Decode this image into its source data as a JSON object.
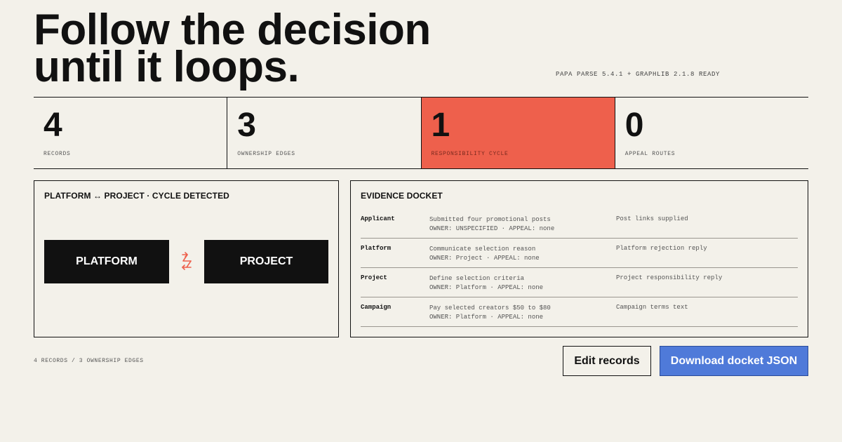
{
  "header": {
    "headline_line1": "Follow the decision",
    "headline_line2": "until it loops.",
    "status": "PAPA PARSE 5.4.1 + GRAPHLIB 2.1.8 READY"
  },
  "stats": [
    {
      "value": "4",
      "label": "RECORDS"
    },
    {
      "value": "3",
      "label": "OWNERSHIP EDGES"
    },
    {
      "value": "1",
      "label": "RESPONSIBILITY CYCLE"
    },
    {
      "value": "0",
      "label": "APPEAL ROUTES"
    }
  ],
  "graph_panel": {
    "title": "PLATFORM ↔ PROJECT · CYCLE DETECTED",
    "node_a": "PLATFORM",
    "node_b": "PROJECT",
    "cycle_icon": "swap-arrows-icon"
  },
  "docket_panel": {
    "title": "EVIDENCE DOCKET",
    "rows": [
      {
        "name": "Applicant",
        "desc": "Submitted four promotional posts",
        "meta": "OWNER: UNSPECIFIED · APPEAL: none",
        "evidence": "Post links supplied"
      },
      {
        "name": "Platform",
        "desc": "Communicate selection reason",
        "meta": "OWNER: Project · APPEAL: none",
        "evidence": "Platform rejection reply"
      },
      {
        "name": "Project",
        "desc": "Define selection criteria",
        "meta": "OWNER: Platform · APPEAL: none",
        "evidence": "Project responsibility reply"
      },
      {
        "name": "Campaign",
        "desc": "Pay selected creators $50 to $80",
        "meta": "OWNER: Platform · APPEAL: none",
        "evidence": "Campaign terms text"
      }
    ]
  },
  "footer": {
    "summary": "4 RECORDS / 3 OWNERSHIP EDGES",
    "edit_label": "Edit records",
    "download_label": "Download docket JSON"
  },
  "colors": {
    "background": "#f3f1ea",
    "alert": "#ee604c",
    "node": "#111111",
    "primary_button": "#4f7ad9"
  }
}
